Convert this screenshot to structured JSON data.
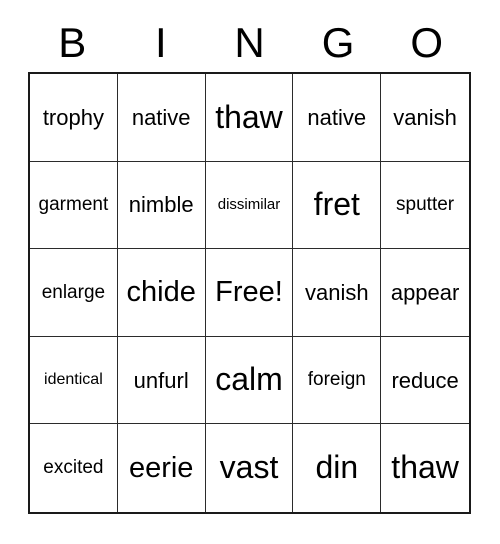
{
  "card": {
    "header_letters": [
      "B",
      "I",
      "N",
      "G",
      "O"
    ],
    "free_space_label": "Free!",
    "grid_size": "5x5",
    "colors": {
      "text": "#000000",
      "grid_line": "#2b2b2b",
      "outer_border": "#1a1a1a",
      "background": "#ffffff"
    },
    "rows": [
      [
        "trophy",
        "native",
        "thaw",
        "native",
        "vanish"
      ],
      [
        "garment",
        "nimble",
        "dissimilar",
        "fret",
        "sputter"
      ],
      [
        "enlarge",
        "chide",
        "Free!",
        "vanish",
        "appear"
      ],
      [
        "identical",
        "unfurl",
        "calm",
        "foreign",
        "reduce"
      ],
      [
        "excited",
        "eerie",
        "vast",
        "din",
        "thaw"
      ]
    ]
  }
}
